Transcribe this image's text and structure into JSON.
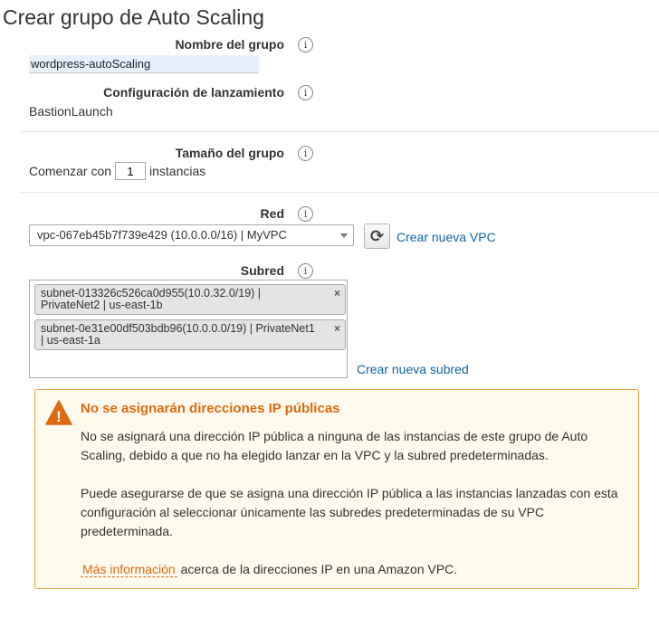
{
  "page_title": "Crear grupo de Auto Scaling",
  "group_name": {
    "label": "Nombre del grupo",
    "value": "wordpress-autoScaling"
  },
  "launch_config": {
    "label": "Configuración de lanzamiento",
    "value": "BastionLaunch"
  },
  "group_size": {
    "label": "Tamaño del grupo",
    "prefix": "Comenzar con",
    "count": "1",
    "suffix": "instancias"
  },
  "network": {
    "label": "Red",
    "selected": "vpc-067eb45b7f739e429 (10.0.0.0/16) | MyVPC",
    "create_link": "Crear nueva VPC"
  },
  "subnet": {
    "label": "Subred",
    "chips": [
      {
        "line1": "subnet-013326c526ca0d955(10.0.32.0/19) |",
        "line2": "PrivateNet2 | us-east-1b"
      },
      {
        "line1": "subnet-0e31e00df503bdb96(10.0.0.0/19) | PrivateNet1",
        "line2": "| us-east-1a"
      }
    ],
    "create_link": "Crear nueva subred"
  },
  "info_glyph": "i",
  "remove_glyph": "×",
  "refresh_glyph": "⟳",
  "alert": {
    "title": "No se asignarán direcciones IP públicas",
    "paragraph1": "No se asignará una dirección IP pública a ninguna de las instancias de este grupo de Auto Scaling, debido a que no ha elegido lanzar en la VPC y la subred predeterminadas.",
    "paragraph2": "Puede asegurarse de que se asigna una dirección IP pública a las instancias lanzadas con esta configuración al seleccionar únicamente las subredes predeterminadas de su VPC predeterminada.",
    "more_link": "Más información",
    "more_text": "acerca de la direcciones IP en una Amazon VPC.",
    "warning_glyph": "!"
  },
  "colors": {
    "link": "#0f64a8",
    "warning": "#de6a10",
    "alert_background": "#fffaee",
    "alert_border": "#e8a33d"
  }
}
